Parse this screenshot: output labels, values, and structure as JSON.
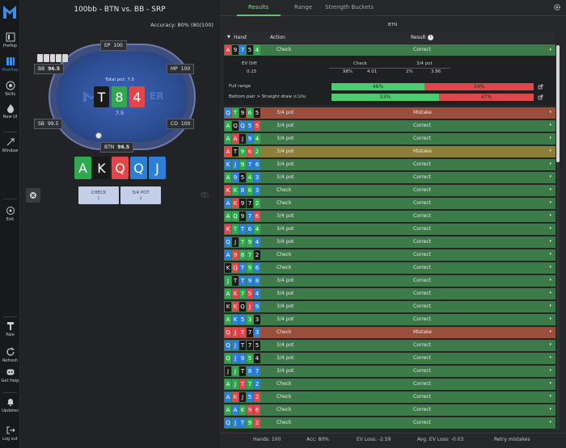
{
  "sidebar": {
    "items": [
      {
        "label": "Preflop",
        "icon": "preflop-icon"
      },
      {
        "label": "Postflop",
        "icon": "postflop-icon"
      },
      {
        "label": "Skills",
        "icon": "skills-icon"
      },
      {
        "label": "New UI",
        "icon": "flame-icon"
      },
      {
        "label": "Window",
        "icon": "window-icon"
      },
      {
        "label": "Exit",
        "icon": "exit-icon"
      },
      {
        "label": "Pale",
        "icon": "brush-icon"
      },
      {
        "label": "Refresh",
        "icon": "refresh-icon"
      },
      {
        "label": "Get Help",
        "icon": "discord-icon"
      },
      {
        "label": "Updates",
        "icon": "bell-icon"
      },
      {
        "label": "Log out",
        "icon": "logout-icon"
      }
    ]
  },
  "left": {
    "title": "100bb - BTN vs. BB - SRP",
    "accuracy": "Accuracy: 80% (80/100)",
    "seats": {
      "ep": {
        "name": "EP",
        "stack": "100"
      },
      "mp": {
        "name": "MP",
        "stack": "100"
      },
      "co": {
        "name": "CO",
        "stack": "100"
      },
      "btn": {
        "name": "BTN",
        "stack": "96.5"
      },
      "sb": {
        "name": "SB",
        "stack": "99.5"
      },
      "bb": {
        "name": "BB",
        "stack": "96.5"
      }
    },
    "pot_label": "Total pot: 7.5",
    "pot_value": "7.5",
    "table_brand": "ER",
    "board": [
      {
        "rank": "T",
        "color": "#1a1a1a"
      },
      {
        "rank": "8",
        "color": "#2fa84f"
      },
      {
        "rank": "4",
        "color": "#e0464a"
      }
    ],
    "hand": [
      {
        "rank": "A",
        "color": "#2fa84f"
      },
      {
        "rank": "K",
        "color": "#1a1a1a"
      },
      {
        "rank": "Q",
        "color": "#e0464a"
      },
      {
        "rank": "Q",
        "color": "#2b7fd6"
      },
      {
        "rank": "J",
        "color": "#2b7fd6"
      }
    ],
    "actions": [
      {
        "label": "CHECK",
        "key": "1"
      },
      {
        "label": "3/4 POT",
        "key": "2"
      }
    ]
  },
  "right": {
    "tabs": [
      "Results",
      "Range",
      "Strength Buckets"
    ],
    "position": "BTN",
    "header": {
      "hand": "Hand",
      "action": "Action",
      "result": "Result"
    },
    "expanded": {
      "cards": [
        {
          "rank": "A",
          "color": "#e0464a"
        },
        {
          "rank": "9",
          "color": "#1a1a1a"
        },
        {
          "rank": "7",
          "color": "#2b7fd6"
        },
        {
          "rank": "5",
          "color": "#1a1a1a"
        },
        {
          "rank": "4",
          "color": "#2fa84f"
        }
      ],
      "action": "Check",
      "result": "Correct",
      "ev_diff_label": "EV Diff",
      "ev_diff": "0.15",
      "col_check": "Check",
      "col_34": "3/4 pot",
      "check_freq": "98%",
      "check_ev": "4.01",
      "pot_freq": "2%",
      "pot_ev": "3.86",
      "full_range_label": "Full range",
      "full_range_check": "46%",
      "full_range_bet": "54%",
      "full_range_check_frac": 0.46,
      "bucket_label": "Bottom pair > Straight draw",
      "bucket_pct": "(4.52%)",
      "bucket_check": "53%",
      "bucket_bet": "47%",
      "bucket_check_frac": 0.53
    },
    "rows": [
      {
        "cards": [
          "Q",
          "T",
          "9",
          "6",
          "5"
        ],
        "colors": [
          "#2b7fd6",
          "#2fa84f",
          "#1a1a1a",
          "#2fa84f",
          "#1a1a1a"
        ],
        "action": "3/4 pot",
        "result": "Mistake",
        "bg": "#9a4f3a"
      },
      {
        "cards": [
          "A",
          "Q",
          "Q",
          "5",
          "5"
        ],
        "colors": [
          "#2fa84f",
          "#1a1a1a",
          "#2b7fd6",
          "#2b7fd6",
          "#e0464a"
        ],
        "action": "3/4 pot",
        "result": "Correct",
        "bg": "#3d7a4a"
      },
      {
        "cards": [
          "A",
          "A",
          "J",
          "9",
          "4"
        ],
        "colors": [
          "#2fa84f",
          "#e0464a",
          "#1a1a1a",
          "#2b7fd6",
          "#2fa84f"
        ],
        "action": "3/4 pot",
        "result": "Correct",
        "bg": "#3d7a4a"
      },
      {
        "cards": [
          "A",
          "T",
          "9",
          "6",
          "2"
        ],
        "colors": [
          "#e0464a",
          "#1a1a1a",
          "#2fa84f",
          "#e0464a",
          "#2fa84f"
        ],
        "action": "3/4 pot",
        "result": "Mistake",
        "bg": "#8c7f3a"
      },
      {
        "cards": [
          "K",
          "J",
          "9",
          "7",
          "6"
        ],
        "colors": [
          "#2b7fd6",
          "#2b7fd6",
          "#2fa84f",
          "#2b7fd6",
          "#2b7fd6"
        ],
        "action": "3/4 pot",
        "result": "Correct",
        "bg": "#3d7a4a"
      },
      {
        "cards": [
          "A",
          "9",
          "5",
          "4",
          "3"
        ],
        "colors": [
          "#2fa84f",
          "#2b7fd6",
          "#1a1a1a",
          "#2fa84f",
          "#2b7fd6"
        ],
        "action": "3/4 pot",
        "result": "Correct",
        "bg": "#3d7a4a"
      },
      {
        "cards": [
          "K",
          "K",
          "8",
          "6",
          "3"
        ],
        "colors": [
          "#e0464a",
          "#2fa84f",
          "#2b7fd6",
          "#2fa84f",
          "#2b7fd6"
        ],
        "action": "Check",
        "result": "Correct",
        "bg": "#3d7a4a"
      },
      {
        "cards": [
          "A",
          "K",
          "9",
          "7",
          "2"
        ],
        "colors": [
          "#2b7fd6",
          "#e0464a",
          "#1a1a1a",
          "#1a1a1a",
          "#2fa84f"
        ],
        "action": "Check",
        "result": "Correct",
        "bg": "#3d7a4a"
      },
      {
        "cards": [
          "A",
          "Q",
          "9",
          "7",
          "6"
        ],
        "colors": [
          "#2fa84f",
          "#2fa84f",
          "#1a1a1a",
          "#2b7fd6",
          "#e0464a"
        ],
        "action": "3/4 pot",
        "result": "Correct",
        "bg": "#3d7a4a"
      },
      {
        "cards": [
          "K",
          "T",
          "T",
          "6",
          "4"
        ],
        "colors": [
          "#e0464a",
          "#2fa84f",
          "#2b7fd6",
          "#2b7fd6",
          "#2fa84f"
        ],
        "action": "3/4 pot",
        "result": "Correct",
        "bg": "#3d7a4a"
      },
      {
        "cards": [
          "Q",
          "J",
          "T",
          "9",
          "4"
        ],
        "colors": [
          "#2b7fd6",
          "#1a1a1a",
          "#2fa84f",
          "#2fa84f",
          "#2b7fd6"
        ],
        "action": "3/4 pot",
        "result": "Correct",
        "bg": "#3d7a4a"
      },
      {
        "cards": [
          "A",
          "9",
          "8",
          "7",
          "2"
        ],
        "colors": [
          "#2b7fd6",
          "#e0464a",
          "#2fa84f",
          "#2fa84f",
          "#1a1a1a"
        ],
        "action": "Check",
        "result": "Correct",
        "bg": "#3d7a4a"
      },
      {
        "cards": [
          "K",
          "Q",
          "T",
          "9",
          "6"
        ],
        "colors": [
          "#1a1a1a",
          "#e0464a",
          "#2b7fd6",
          "#2fa84f",
          "#2b7fd6"
        ],
        "action": "Check",
        "result": "Correct",
        "bg": "#3d7a4a"
      },
      {
        "cards": [
          "J",
          "T",
          "T",
          "9",
          "8"
        ],
        "colors": [
          "#2fa84f",
          "#1a1a1a",
          "#2b7fd6",
          "#2b7fd6",
          "#2b7fd6"
        ],
        "action": "3/4 pot",
        "result": "Correct",
        "bg": "#3d7a4a"
      },
      {
        "cards": [
          "A",
          "K",
          "7",
          "5",
          "4"
        ],
        "colors": [
          "#2fa84f",
          "#e0464a",
          "#2fa84f",
          "#e0464a",
          "#2b7fd6"
        ],
        "action": "3/4 pot",
        "result": "Correct",
        "bg": "#3d7a4a"
      },
      {
        "cards": [
          "K",
          "K",
          "Q",
          "J",
          "9"
        ],
        "colors": [
          "#1a1a1a",
          "#e0464a",
          "#1a1a1a",
          "#e0464a",
          "#2b7fd6"
        ],
        "action": "3/4 pot",
        "result": "Correct",
        "bg": "#3d7a4a"
      },
      {
        "cards": [
          "A",
          "K",
          "5",
          "3",
          "3"
        ],
        "colors": [
          "#2fa84f",
          "#2b7fd6",
          "#2b7fd6",
          "#2fa84f",
          "#1a1a1a"
        ],
        "action": "3/4 pot",
        "result": "Correct",
        "bg": "#3d7a4a"
      },
      {
        "cards": [
          "Q",
          "J",
          "T",
          "7",
          "3"
        ],
        "colors": [
          "#e0464a",
          "#e0464a",
          "#e0464a",
          "#1a1a1a",
          "#2b7fd6"
        ],
        "action": "Check",
        "result": "Mistake",
        "bg": "#9a4f3a"
      },
      {
        "cards": [
          "Q",
          "J",
          "T",
          "7",
          "5"
        ],
        "colors": [
          "#2b7fd6",
          "#2b7fd6",
          "#1a1a1a",
          "#1a1a1a",
          "#1a1a1a"
        ],
        "action": "3/4 pot",
        "result": "Correct",
        "bg": "#3d7a4a"
      },
      {
        "cards": [
          "Q",
          "J",
          "9",
          "5",
          "4"
        ],
        "colors": [
          "#2fa84f",
          "#2b7fd6",
          "#2b7fd6",
          "#2fa84f",
          "#1a1a1a"
        ],
        "action": "3/4 pot",
        "result": "Correct",
        "bg": "#3d7a4a"
      },
      {
        "cards": [
          "J",
          "J",
          "T",
          "8",
          "7"
        ],
        "colors": [
          "#1a1a1a",
          "#2fa84f",
          "#1a1a1a",
          "#2b7fd6",
          "#2b7fd6"
        ],
        "action": "3/4 pot",
        "result": "Correct",
        "bg": "#3d7a4a"
      },
      {
        "cards": [
          "A",
          "J",
          "T",
          "7",
          "2"
        ],
        "colors": [
          "#2fa84f",
          "#2fa84f",
          "#e0464a",
          "#2fa84f",
          "#2b7fd6"
        ],
        "action": "Check",
        "result": "Correct",
        "bg": "#3d7a4a"
      },
      {
        "cards": [
          "A",
          "K",
          "J",
          "5",
          "2"
        ],
        "colors": [
          "#2b7fd6",
          "#e0464a",
          "#1a1a1a",
          "#2b7fd6",
          "#e0464a"
        ],
        "action": "Check",
        "result": "Correct",
        "bg": "#3d7a4a"
      },
      {
        "cards": [
          "A",
          "A",
          "K",
          "9",
          "6"
        ],
        "colors": [
          "#2fa84f",
          "#2b7fd6",
          "#2fa84f",
          "#e0464a",
          "#e0464a"
        ],
        "action": "Check",
        "result": "Correct",
        "bg": "#3d7a4a"
      },
      {
        "cards": [
          "Q",
          "J",
          "T",
          "9",
          "2"
        ],
        "colors": [
          "#2b7fd6",
          "#2b7fd6",
          "#2b7fd6",
          "#2fa84f",
          "#e0464a"
        ],
        "action": "Check",
        "result": "Correct",
        "bg": "#3d7a4a"
      }
    ],
    "footer": {
      "hands": "Hands: 100",
      "acc": "Acc: 80%",
      "ev_loss": "EV Loss: -2.59",
      "avg_ev_loss": "Avg. EV Loss: -0.03",
      "retry": "Retry mistakes"
    }
  },
  "colors": {
    "correct": "#3d7a4a",
    "mistake": "#9a4f3a",
    "check_bar": "#4ccc6f",
    "bet_bar": "#e0464a",
    "accent": "#5fbf73"
  }
}
